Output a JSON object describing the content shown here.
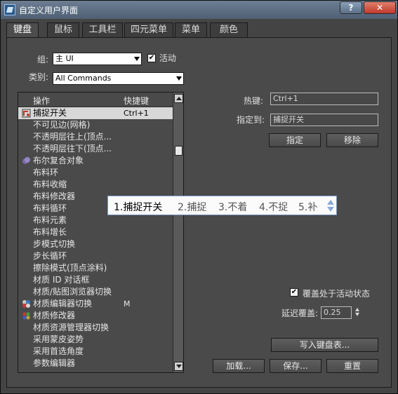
{
  "window": {
    "title": "自定义用户界面",
    "help_label": "?",
    "close_label": "✕"
  },
  "tabs": [
    {
      "label": "键盘",
      "active": true
    },
    {
      "label": "鼠标"
    },
    {
      "label": "工具栏"
    },
    {
      "label": "四元菜单"
    },
    {
      "label": "菜单"
    },
    {
      "label": "颜色"
    }
  ],
  "group": {
    "label": "组:",
    "value": "主 UI",
    "active_label": "活动",
    "active_checked": true
  },
  "category": {
    "label": "类别:",
    "value": "All Commands"
  },
  "list": {
    "header_action": "操作",
    "header_shortcut": "快捷键",
    "rows": [
      {
        "label": "捕捉开关",
        "shortcut": "Ctrl+1",
        "icon": "snap-icon",
        "selected": true
      },
      {
        "label": "不可见边(网格)",
        "shortcut": ""
      },
      {
        "label": "不透明层往上(顶点...",
        "shortcut": ""
      },
      {
        "label": "不透明层往下(顶点...",
        "shortcut": ""
      },
      {
        "label": "布尔复合对象",
        "shortcut": "",
        "icon": "boolean-icon"
      },
      {
        "label": "布料环",
        "shortcut": ""
      },
      {
        "label": "布料收缩",
        "shortcut": ""
      },
      {
        "label": "布料修改器",
        "shortcut": ""
      },
      {
        "label": "布料循环",
        "shortcut": ""
      },
      {
        "label": "布料元素",
        "shortcut": ""
      },
      {
        "label": "布料增长",
        "shortcut": ""
      },
      {
        "label": "步模式切换",
        "shortcut": ""
      },
      {
        "label": "步长循环",
        "shortcut": ""
      },
      {
        "label": "擦除模式(顶点涂料)",
        "shortcut": ""
      },
      {
        "label": "材质 ID 对话框",
        "shortcut": ""
      },
      {
        "label": "材质/贴图浏览器切换",
        "shortcut": ""
      },
      {
        "label": "材质编辑器切换",
        "shortcut": "M",
        "icon": "material-editor-icon"
      },
      {
        "label": "材质修改器",
        "shortcut": "",
        "icon": "material-modifier-icon"
      },
      {
        "label": "材质资源管理器切换",
        "shortcut": ""
      },
      {
        "label": "采用蒙皮姿势",
        "shortcut": ""
      },
      {
        "label": "采用首选角度",
        "shortcut": ""
      },
      {
        "label": "参数编辑器",
        "shortcut": ""
      }
    ]
  },
  "hotkey": {
    "label": "热键:",
    "value": "Ctrl+1"
  },
  "assigned_to": {
    "label": "指定到:",
    "value": "捕捉开关"
  },
  "buttons": {
    "assign": "指定",
    "remove": "移除",
    "write_keyboard_chart": "写入键盘表...",
    "load": "加载...",
    "save": "保存...",
    "reset": "重置"
  },
  "override": {
    "label": "覆盖处于活动状态",
    "checked": true
  },
  "delay_override": {
    "label": "延迟覆盖:",
    "value": "0.25"
  },
  "ime": {
    "candidates": [
      "1.捕捉开关",
      "2.捕捉",
      "3.不着",
      "4.不捉",
      "5.补"
    ]
  }
}
